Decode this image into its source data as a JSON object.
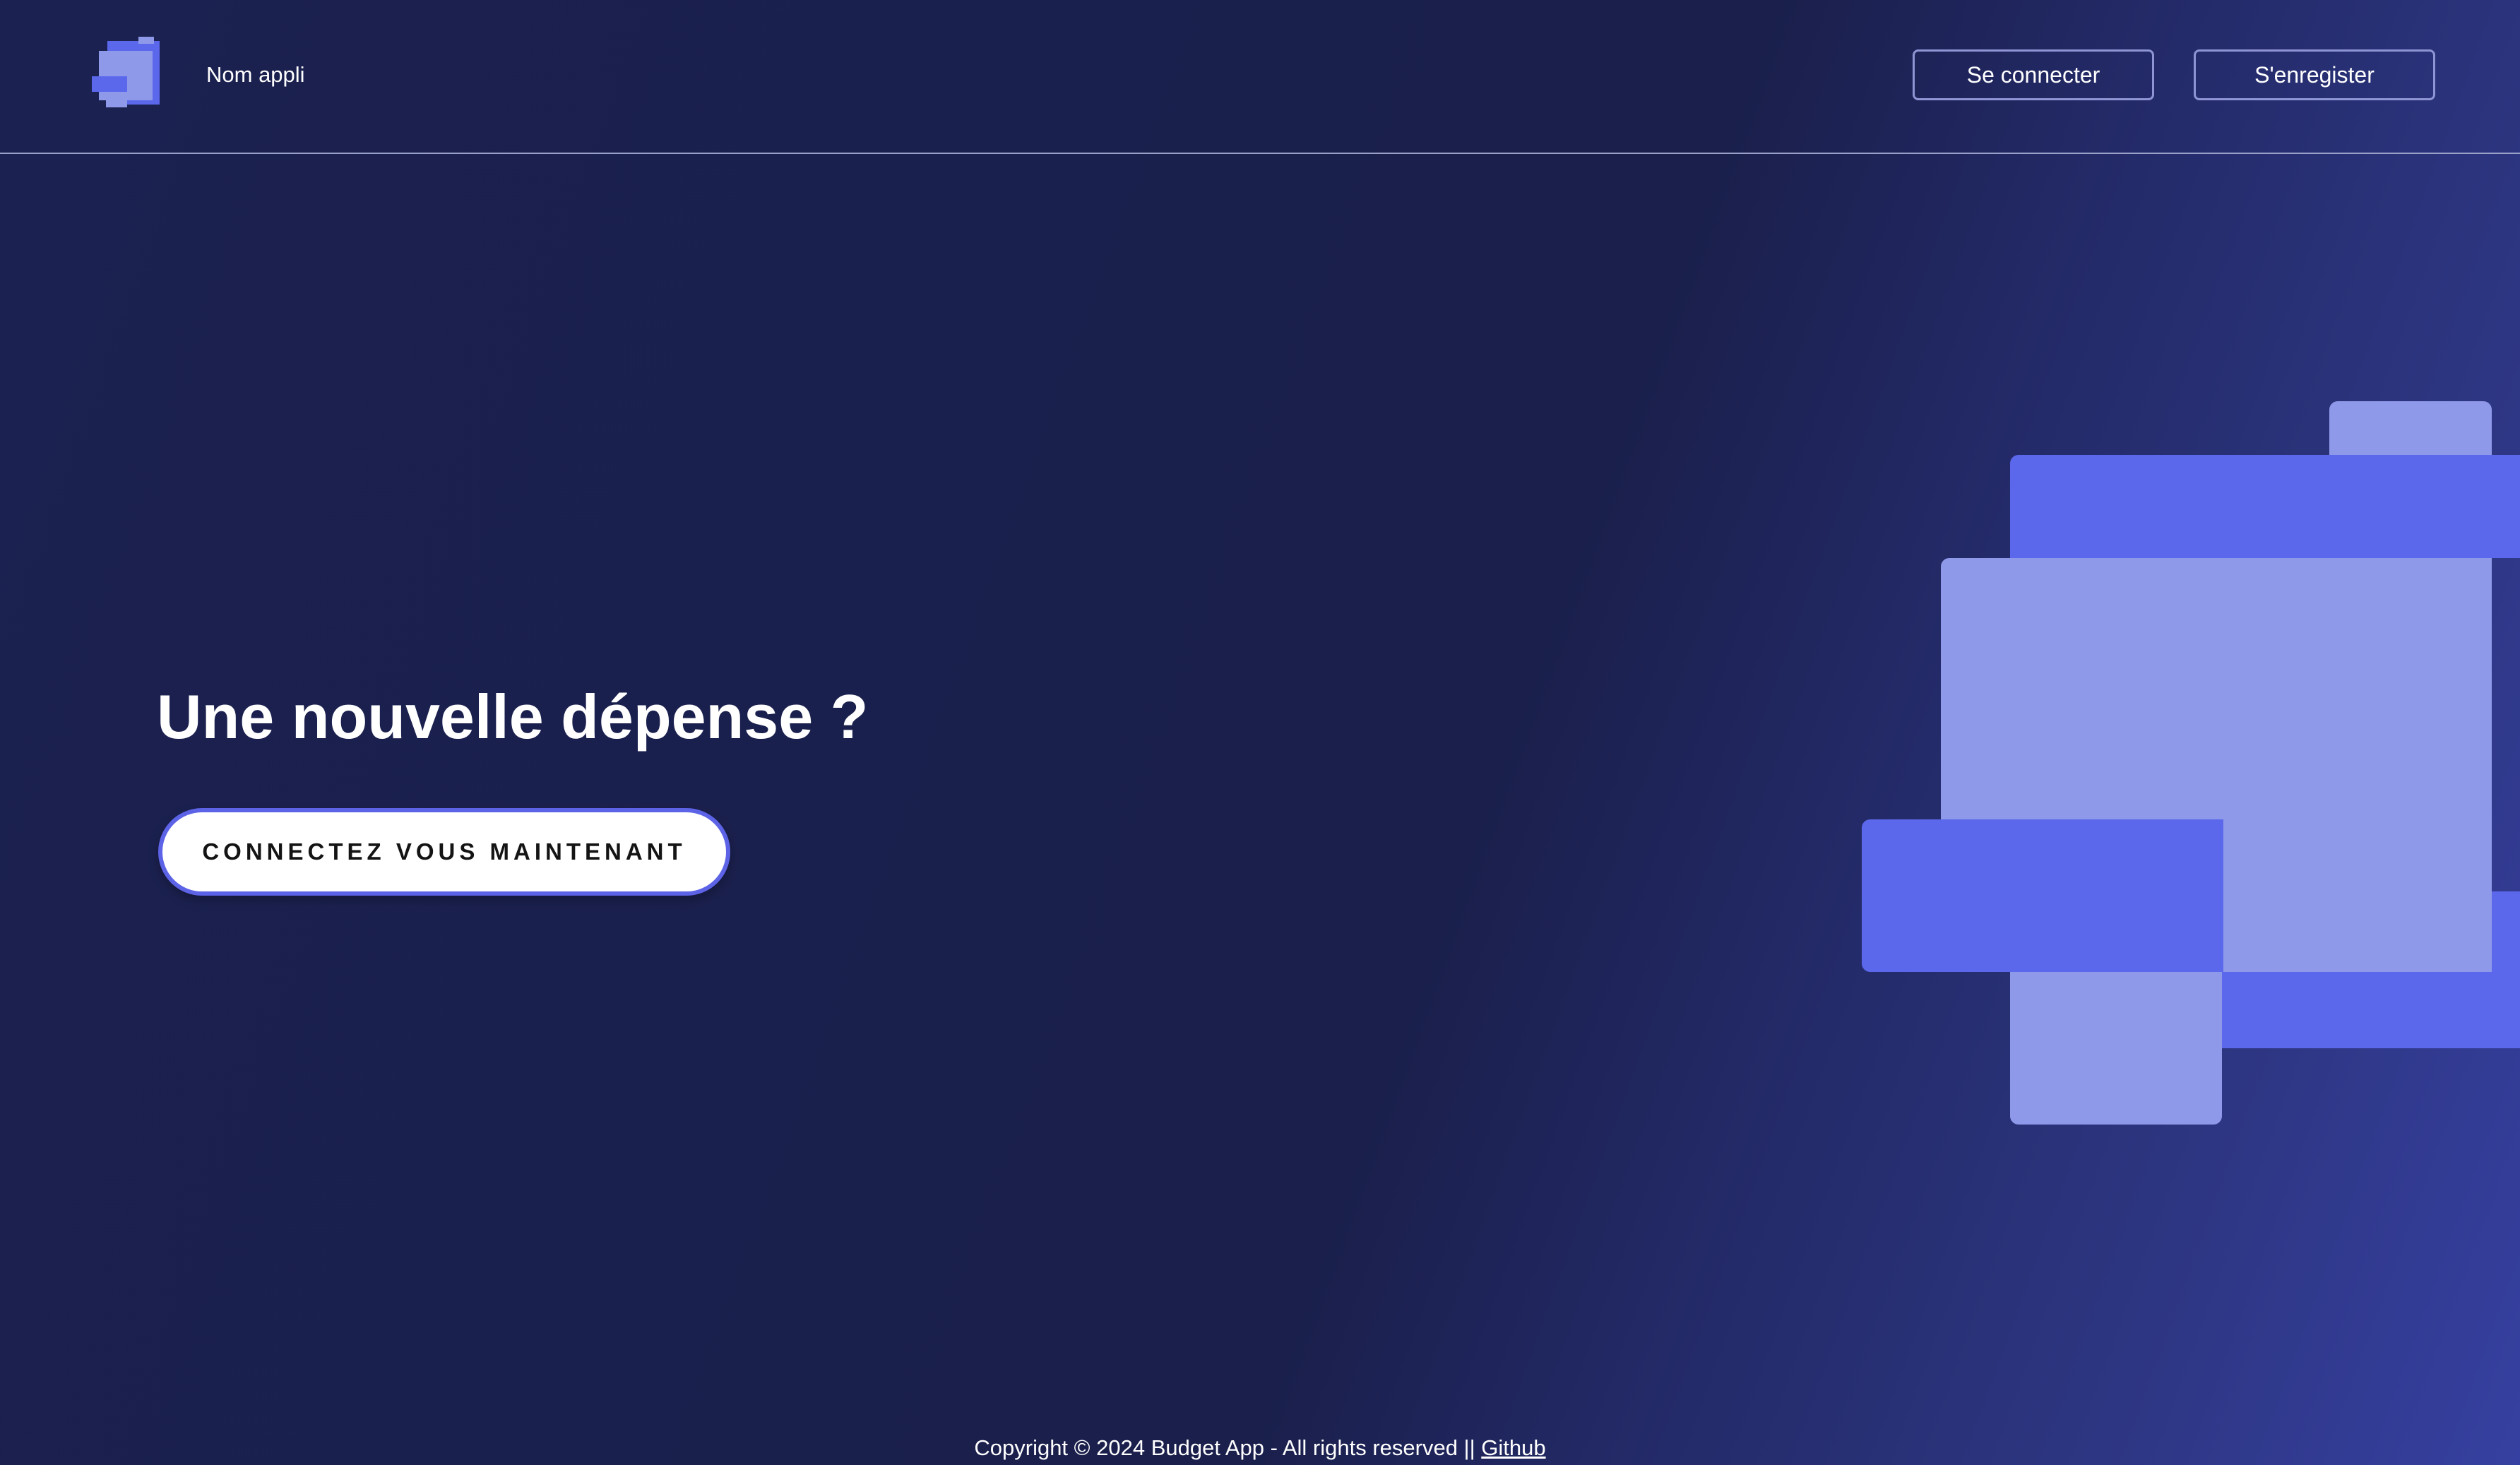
{
  "header": {
    "app_name": "Nom appli",
    "login_label": "Se connecter",
    "register_label": "S'enregister"
  },
  "hero": {
    "title": "Une nouvelle dépense ?",
    "cta_label": "CONNECTEZ VOUS MAINTENANT"
  },
  "footer": {
    "copyright": "Copyright © 2024 Budget App - All rights reserved || ",
    "github_label": "Github"
  },
  "icons": {
    "logo": "app-logo-blocks-icon"
  },
  "colors": {
    "background": "#1a1f4b",
    "accent_dark": "#5c68ec",
    "accent_light": "#8f99e9",
    "button_border": "#8f95d4"
  }
}
